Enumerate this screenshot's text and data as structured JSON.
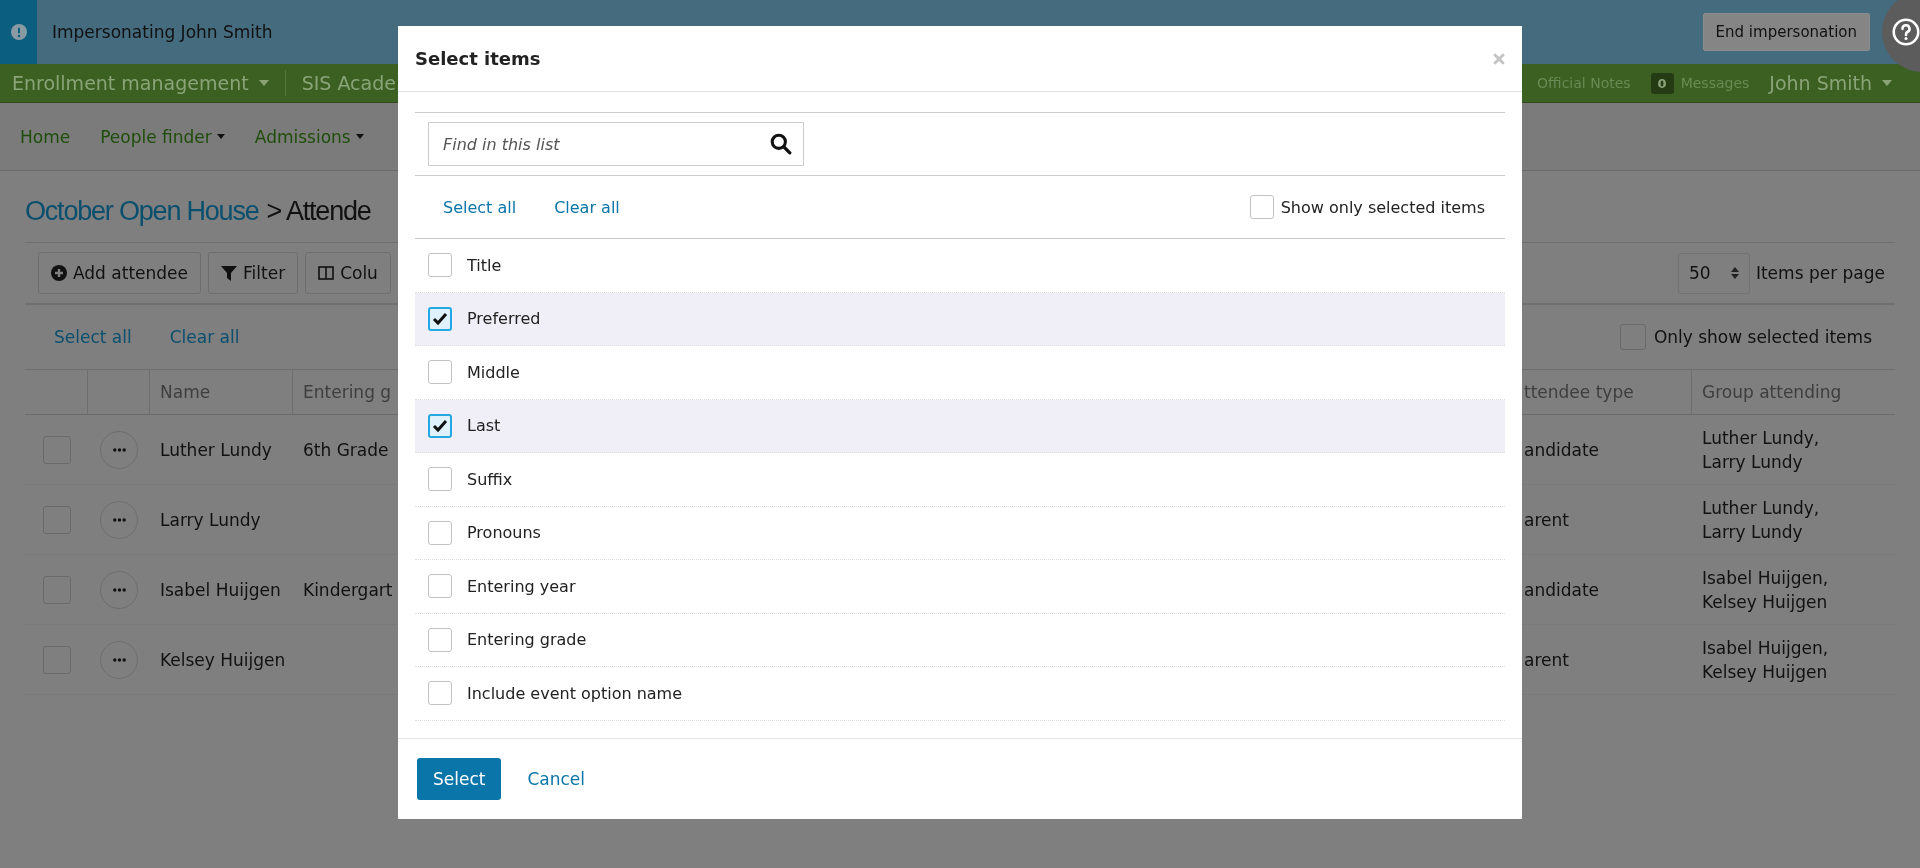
{
  "impersonation_bar": {
    "message": "Impersonating John Smith",
    "end_button": "End impersonation"
  },
  "top_nav": {
    "left": [
      {
        "label": "Enrollment management",
        "dropdown": true
      },
      {
        "label": "SIS Acade",
        "dropdown": false
      }
    ],
    "official_notes": "Official Notes",
    "messages_count": "0",
    "messages_label": "Messages",
    "user": {
      "label": "John Smith",
      "dropdown": true
    }
  },
  "menu": [
    {
      "label": "Home",
      "dropdown": false
    },
    {
      "label": "People finder",
      "dropdown": true
    },
    {
      "label": "Admissions",
      "dropdown": true
    }
  ],
  "page": {
    "breadcrumb_link": "October Open House",
    "separator": ">",
    "current": "Attende"
  },
  "toolbar": [
    {
      "label": "Add attendee",
      "kind": "add"
    },
    {
      "label": "Filter",
      "kind": "filter"
    },
    {
      "label": "Colu",
      "kind": "columns"
    }
  ],
  "page_size": {
    "value": "50",
    "label": "Items per page"
  },
  "selection": {
    "select_all": "Select all",
    "clear_all": "Clear all",
    "only_selected": {
      "label": "Only show selected items",
      "checked": false
    }
  },
  "table": {
    "columns": [
      "Name",
      "Entering g",
      "ttendee type",
      "Group attending"
    ],
    "rows": [
      {
        "checked": false,
        "name": "Luther Lundy",
        "grade": "6th Grade",
        "type": "andidate",
        "group": "Luther Lundy, Larry Lundy"
      },
      {
        "checked": false,
        "name": "Larry Lundy",
        "type": "arent",
        "group": "Luther Lundy, Larry Lundy"
      },
      {
        "checked": false,
        "name": "Isabel Huijgen",
        "grade": "Kindergart",
        "type": "andidate",
        "group": "Isabel Huijgen, Kelsey Huijgen"
      },
      {
        "checked": false,
        "name": "Kelsey Huijgen",
        "type": "arent",
        "group": "Isabel Huijgen, Kelsey Huijgen"
      }
    ]
  },
  "modal": {
    "title": "Select items",
    "search": {
      "placeholder": "Find in this list"
    },
    "select_all": "Select all",
    "clear_all": "Clear all",
    "show_only": {
      "label": "Show only selected items",
      "checked": false
    },
    "items": [
      {
        "label": "Title",
        "checked": false
      },
      {
        "label": "Preferred",
        "checked": true
      },
      {
        "label": "Middle",
        "checked": false
      },
      {
        "label": "Last",
        "checked": true
      },
      {
        "label": "Suffix",
        "checked": false
      },
      {
        "label": "Pronouns",
        "checked": false
      },
      {
        "label": "Entering year",
        "checked": false
      },
      {
        "label": "Entering grade",
        "checked": false
      },
      {
        "label": "Include event option name",
        "checked": false
      }
    ],
    "primary_button": "Select",
    "cancel_link": "Cancel"
  }
}
